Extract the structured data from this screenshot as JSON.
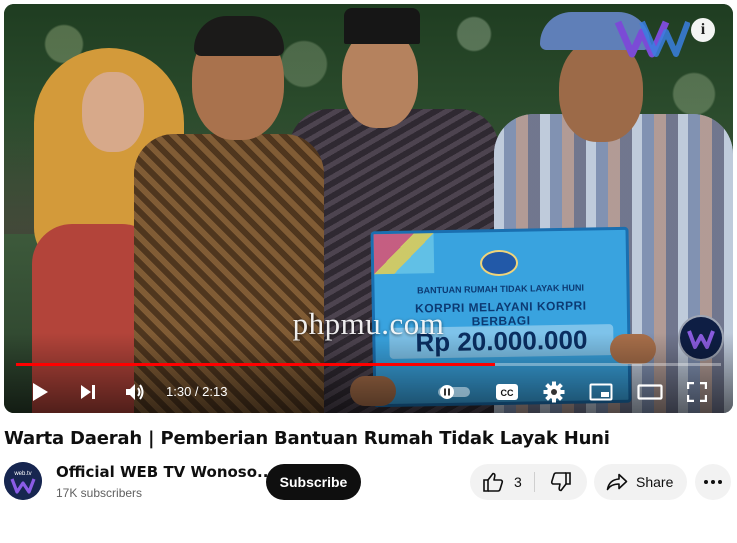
{
  "player": {
    "watermark": "phpmu.com",
    "signboard": {
      "line1": "BANTUAN RUMAH TIDAK LAYAK HUNI",
      "line2": "KORPRI MELAYANI KORPRI BERBAGI",
      "amount": "Rp 20.000.000"
    },
    "time_display": "1:30 / 2:13",
    "progress": {
      "played_fraction": 0.68,
      "loaded_fraction": 0.68
    },
    "icons": {
      "play": "play-icon",
      "next": "next-icon",
      "volume": "volume-icon",
      "autoplay": "autoplay-toggle-icon",
      "captions": "captions-icon",
      "settings": "gear-icon",
      "miniplayer": "miniplayer-icon",
      "theater": "theater-icon",
      "fullscreen": "fullscreen-icon",
      "info": "info-icon"
    },
    "colors": {
      "progress_played": "#ff0000"
    }
  },
  "video": {
    "title": "Warta Daerah | Pemberian Bantuan Rumah Tidak Layak Huni"
  },
  "channel": {
    "name": "Official WEB TV Wonoso...",
    "subscribers": "17K subscribers",
    "subscribe_label": "Subscribe",
    "avatar_text": "web.tv"
  },
  "actions": {
    "like_count": "3",
    "share_label": "Share"
  }
}
